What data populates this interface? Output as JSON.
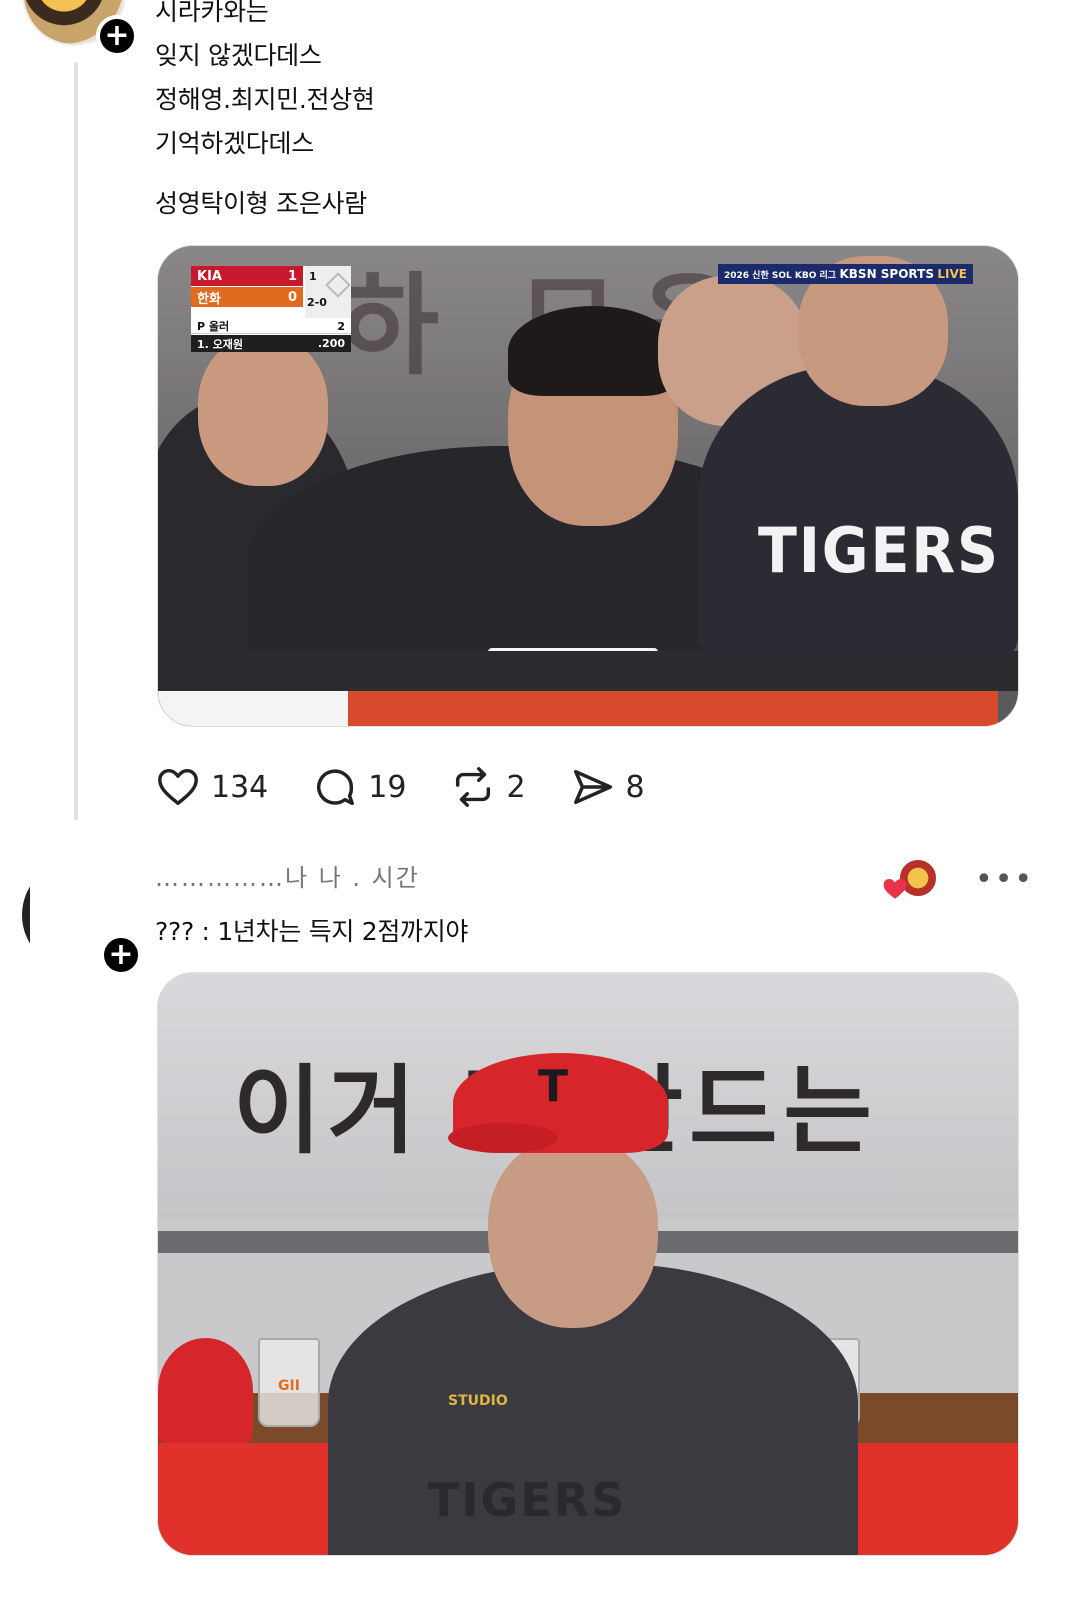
{
  "post1": {
    "text_lines": [
      "시라카와는",
      "잊지 않겠다데스",
      "정해영.최지민.전상현",
      "기억하겠다데스"
    ],
    "text_extra": "성영탁이형 조은사람",
    "photo": {
      "scorebug": {
        "team1": "KIA",
        "team1_score": "1",
        "team2": "한화",
        "team2_score": "0",
        "inning": "1",
        "count": "2-0",
        "pitcher": "P 올러",
        "pitch_count": "2",
        "batter": "1. 오재원",
        "avg": ".200"
      },
      "broadcast": "KBSN SPORTS",
      "live": "LIVE",
      "league": "2026 신한 SOL KBO 리그",
      "jersey_text": "TIGERS",
      "banner_text": "하 모음"
    },
    "actions": {
      "likes": "134",
      "replies": "19",
      "reposts": "2",
      "shares": "8"
    }
  },
  "post2": {
    "username": "……………나 나 . 시간",
    "text": "??? : 1년차는 득지 2점까지야",
    "more": "•••",
    "photo": {
      "wall_text": "이거   면 만드는",
      "cap_logo": "T",
      "cup_label": "GII",
      "shirt_text": "TIGERS",
      "studio_text": "STUDIO"
    }
  },
  "colors": {
    "text": "#111111",
    "action_icon": "#222222",
    "like_heart": "#e8344b",
    "thread_line": "#e3e3e3"
  }
}
